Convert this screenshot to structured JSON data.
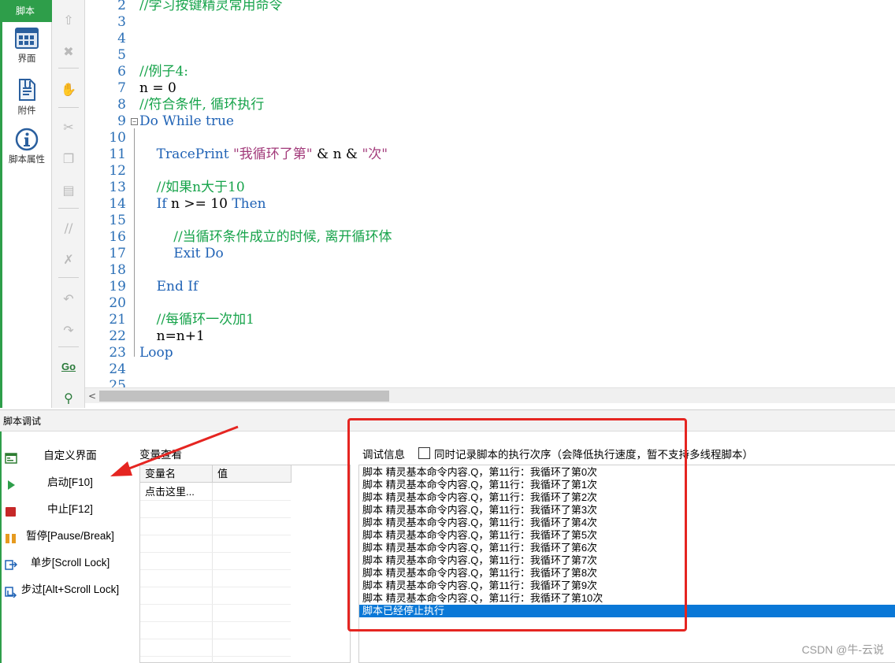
{
  "sidebar": {
    "tab_label": "脚本",
    "items": [
      {
        "label": "界面",
        "icon": "layout-grid-icon"
      },
      {
        "label": "附件",
        "icon": "attachment-document-icon"
      },
      {
        "label": "脚本属性",
        "icon": "info-icon"
      }
    ]
  },
  "toolbar": {
    "icons": [
      "move-up-icon",
      "delete-icon",
      "hand-icon",
      "cut-icon",
      "copy-icon",
      "paste-icon",
      "comment-icon",
      "uncomment-icon",
      "undo-icon",
      "redo-icon",
      "goto-icon",
      "find-icon"
    ]
  },
  "editor": {
    "lines": [
      {
        "n": "2",
        "text": "//学习按键精灵常用命令",
        "type": "comment"
      },
      {
        "n": "3",
        "text": "",
        "type": "plain"
      },
      {
        "n": "4",
        "text": "",
        "type": "plain"
      },
      {
        "n": "5",
        "text": "",
        "type": "plain"
      },
      {
        "n": "6",
        "text": "//例子4:",
        "type": "comment"
      },
      {
        "n": "7",
        "text": "n = 0",
        "type": "plain"
      },
      {
        "n": "8",
        "text": "//符合条件, 循环执行",
        "type": "comment"
      },
      {
        "n": "9",
        "text": "Do While true",
        "type": "keyword"
      },
      {
        "n": "10",
        "text": "",
        "type": "plain"
      },
      {
        "n": "11",
        "kw": "    TracePrint ",
        "str": "\"我循环了第\"",
        "rest": " & n & ",
        "str2": "\"次\"",
        "type": "trace"
      },
      {
        "n": "12",
        "text": "",
        "type": "plain"
      },
      {
        "n": "13",
        "text": "    //如果n大于10",
        "type": "comment"
      },
      {
        "n": "14",
        "kw": "    If",
        "rest": " n >= 10 ",
        "kw2": "Then",
        "type": "ifline"
      },
      {
        "n": "15",
        "text": "",
        "type": "plain"
      },
      {
        "n": "16",
        "text": "        //当循环条件成立的时候, 离开循环体",
        "type": "comment"
      },
      {
        "n": "17",
        "text": "        Exit Do",
        "type": "keyword"
      },
      {
        "n": "18",
        "text": "",
        "type": "plain"
      },
      {
        "n": "19",
        "text": "    End If",
        "type": "keyword"
      },
      {
        "n": "20",
        "text": "",
        "type": "plain"
      },
      {
        "n": "21",
        "text": "    //每循环一次加1",
        "type": "comment"
      },
      {
        "n": "22",
        "text": "    n=n+1",
        "type": "plain"
      },
      {
        "n": "23",
        "text": "Loop",
        "type": "keyword"
      },
      {
        "n": "24",
        "text": "",
        "type": "plain"
      },
      {
        "n": "25",
        "text": "",
        "type": "plain"
      }
    ]
  },
  "debug": {
    "header": "脚本调试",
    "buttons": [
      {
        "label": "自定义界面",
        "icon": "custom-ui-icon",
        "color": "#2e7d32"
      },
      {
        "label": "启动[F10]",
        "icon": "play-icon",
        "color": "#2e9e4a"
      },
      {
        "label": "中止[F12]",
        "icon": "stop-icon",
        "color": "#c62828"
      },
      {
        "label": "暂停[Pause/Break]",
        "icon": "pause-icon",
        "color": "#e69a1f"
      },
      {
        "label": "单步[Scroll Lock]",
        "icon": "step-into-icon",
        "color": "#1f62b5"
      },
      {
        "label": "步过[Alt+Scroll Lock]",
        "icon": "step-over-icon",
        "color": "#1f62b5"
      }
    ],
    "variables": {
      "title": "变量查看",
      "col_name": "变量名",
      "col_value": "值",
      "rows": [
        {
          "name": "点击这里...",
          "value": ""
        }
      ]
    },
    "info": {
      "title": "调试信息",
      "checkbox_label": "同时记录脚本的执行次序（会降低执行速度，暂不支持多线程脚本）",
      "checkbox_checked": false,
      "log": [
        "脚本 精灵基本命令内容.Q，第11行：我循环了第0次",
        "脚本 精灵基本命令内容.Q，第11行：我循环了第1次",
        "脚本 精灵基本命令内容.Q，第11行：我循环了第2次",
        "脚本 精灵基本命令内容.Q，第11行：我循环了第3次",
        "脚本 精灵基本命令内容.Q，第11行：我循环了第4次",
        "脚本 精灵基本命令内容.Q，第11行：我循环了第5次",
        "脚本 精灵基本命令内容.Q，第11行：我循环了第6次",
        "脚本 精灵基本命令内容.Q，第11行：我循环了第7次",
        "脚本 精灵基本命令内容.Q，第11行：我循环了第8次",
        "脚本 精灵基本命令内容.Q，第11行：我循环了第9次",
        "脚本 精灵基本命令内容.Q，第11行：我循环了第10次",
        "脚本已经停止执行"
      ],
      "selected_index": 11
    }
  },
  "watermark": "CSDN @牛-云说",
  "colors": {
    "accent_green": "#2e9e4a",
    "comment": "#16a34a",
    "keyword": "#1f62b5",
    "string": "#a23a7a",
    "selection": "#0a78d7",
    "annotation_red": "#e52521"
  }
}
